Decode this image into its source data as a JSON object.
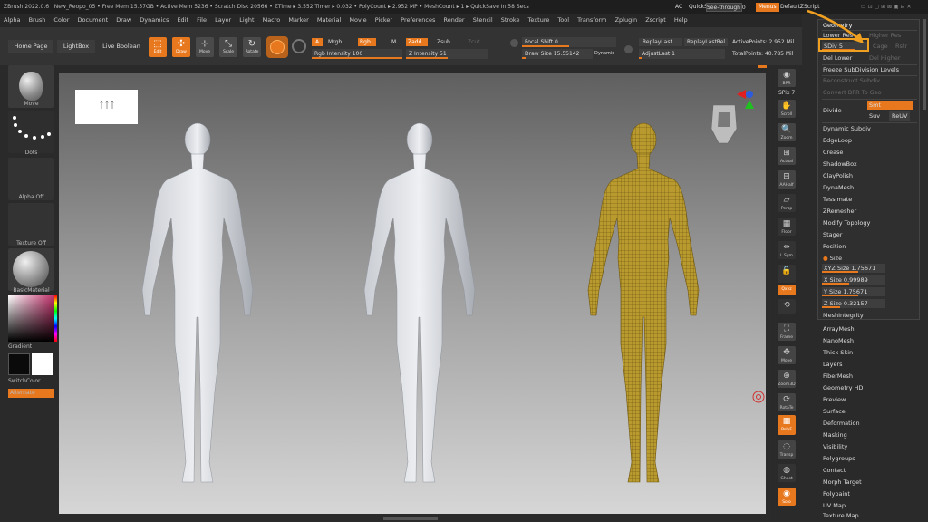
{
  "titlebar": {
    "app": "ZBrush 2022.0.6",
    "info": "New_Reopo_05   • Free Mem 15.57GB • Active Mem 5236 • Scratch Disk 20566 • ZTime ▸ 3.552 Timer ▸ 0.032 • PolyCount ▸ 2.952 MP • MeshCount ▸ 1 ▸ QuickSave In 58 Secs",
    "ac": "AC",
    "quicksave": "QuickSave",
    "see_through": "See-through 0",
    "menus_btn": "Menus",
    "script": "DefaultZScript"
  },
  "menubar": [
    "Alpha",
    "Brush",
    "Color",
    "Document",
    "Draw",
    "Dynamics",
    "Edit",
    "File",
    "Layer",
    "Light",
    "Macro",
    "Marker",
    "Material",
    "Movie",
    "Picker",
    "Preferences",
    "Render",
    "Stencil",
    "Stroke",
    "Texture",
    "Tool",
    "Transform",
    "Zplugin",
    "Zscript",
    "Help"
  ],
  "toolbar": {
    "home_page": "Home Page",
    "lightbox": "LightBox",
    "live_boolean": "Live Boolean",
    "edit": "Edit",
    "draw": "Draw",
    "move": "Move",
    "scale": "Scale",
    "rotate": "Rotate",
    "a_label": "A",
    "mrgb": "Mrgb",
    "rgb": "Rgb",
    "m": "M",
    "rgb_intensity": "Rgb Intensity 100",
    "zadd": "Zadd",
    "zsub": "Zsub",
    "zcut": "Zcut",
    "z_intensity": "Z Intensity 51",
    "focal_shift": "Focal Shift 0",
    "draw_size": "Draw Size 15.55142",
    "dynamic": "Dynamic",
    "replay_last": "ReplayLast",
    "replay_last_rel": "ReplayLastRel",
    "adjust_last": "AdjustLast 1",
    "active_points": "ActivePoints: 2.952 Mil",
    "total_points": "TotalPoints: 40.785 Mil",
    "rgb_intensity_value": 100,
    "z_intensity_value": 51,
    "focal_shift_value": 0,
    "draw_size_value": 15.55142
  },
  "left_panel": {
    "move": "Move",
    "dots": "Dots",
    "alpha_off": "Alpha Off",
    "texture_off": "Texture Off",
    "basic_material": "BasicMaterial",
    "gradient": "Gradient",
    "switch_color": "SwitchColor",
    "alternate": "Alternate"
  },
  "right_shelf": [
    "BPR",
    "SPix 7",
    "Scroll",
    "Zoom",
    "Actual",
    "AAHalf",
    "Persp",
    "Floor",
    "L.Sym",
    "",
    "Qxyz",
    "",
    "Frame",
    "Move",
    "Zoom3D",
    "RotaTe",
    "",
    "PolyF",
    "Transp",
    "Ghost",
    "Solo"
  ],
  "geometry": {
    "title": "Geometry",
    "lower_res": "Lower Res",
    "higher_res": "Higher Res",
    "sdiv": "SDiv 5",
    "sdiv_value": 5,
    "cage": "Cage",
    "rstr": "Rstr",
    "del_lower": "Del Lower",
    "del_higher": "Del Higher",
    "freeze": "Freeze SubDivision Levels",
    "reconstruct": "Reconstruct Subdiv",
    "convert_bpr": "Convert BPR To Geo",
    "divide": "Divide",
    "smt": "Smt",
    "suv": "Suv",
    "reuv": "ReUV",
    "dynamic_subdiv": "Dynamic Subdiv",
    "edgeloop": "EdgeLoop",
    "crease": "Crease",
    "shadowbox": "ShadowBox",
    "claypolish": "ClayPolish",
    "dynamesh": "DynaMesh",
    "tessimate": "Tessimate",
    "zremesher": "ZRemesher",
    "modify_topology": "Modify Topology",
    "stager": "Stager",
    "position": "Position",
    "size": "Size",
    "xyz_size": "XYZ Size 1.75671",
    "x_size": "X Size 0.99989",
    "y_size": "Y Size 1.75671",
    "z_size": "Z Size 0.32157",
    "meshintegrity": "MeshIntegrity"
  },
  "tool_subpalettes": [
    "ArrayMesh",
    "NanoMesh",
    "Thick Skin",
    "Layers",
    "FiberMesh",
    "Geometry HD",
    "Preview",
    "Surface",
    "Deformation",
    "Masking",
    "Visibility",
    "Polygroups",
    "Contact",
    "Morph Target",
    "Polypaint",
    "UV Map",
    "Texture Map"
  ],
  "colors": {
    "accent": "#e8781e",
    "highlight_box": "#f0a020",
    "mesh_yellow": "#b8962a"
  }
}
